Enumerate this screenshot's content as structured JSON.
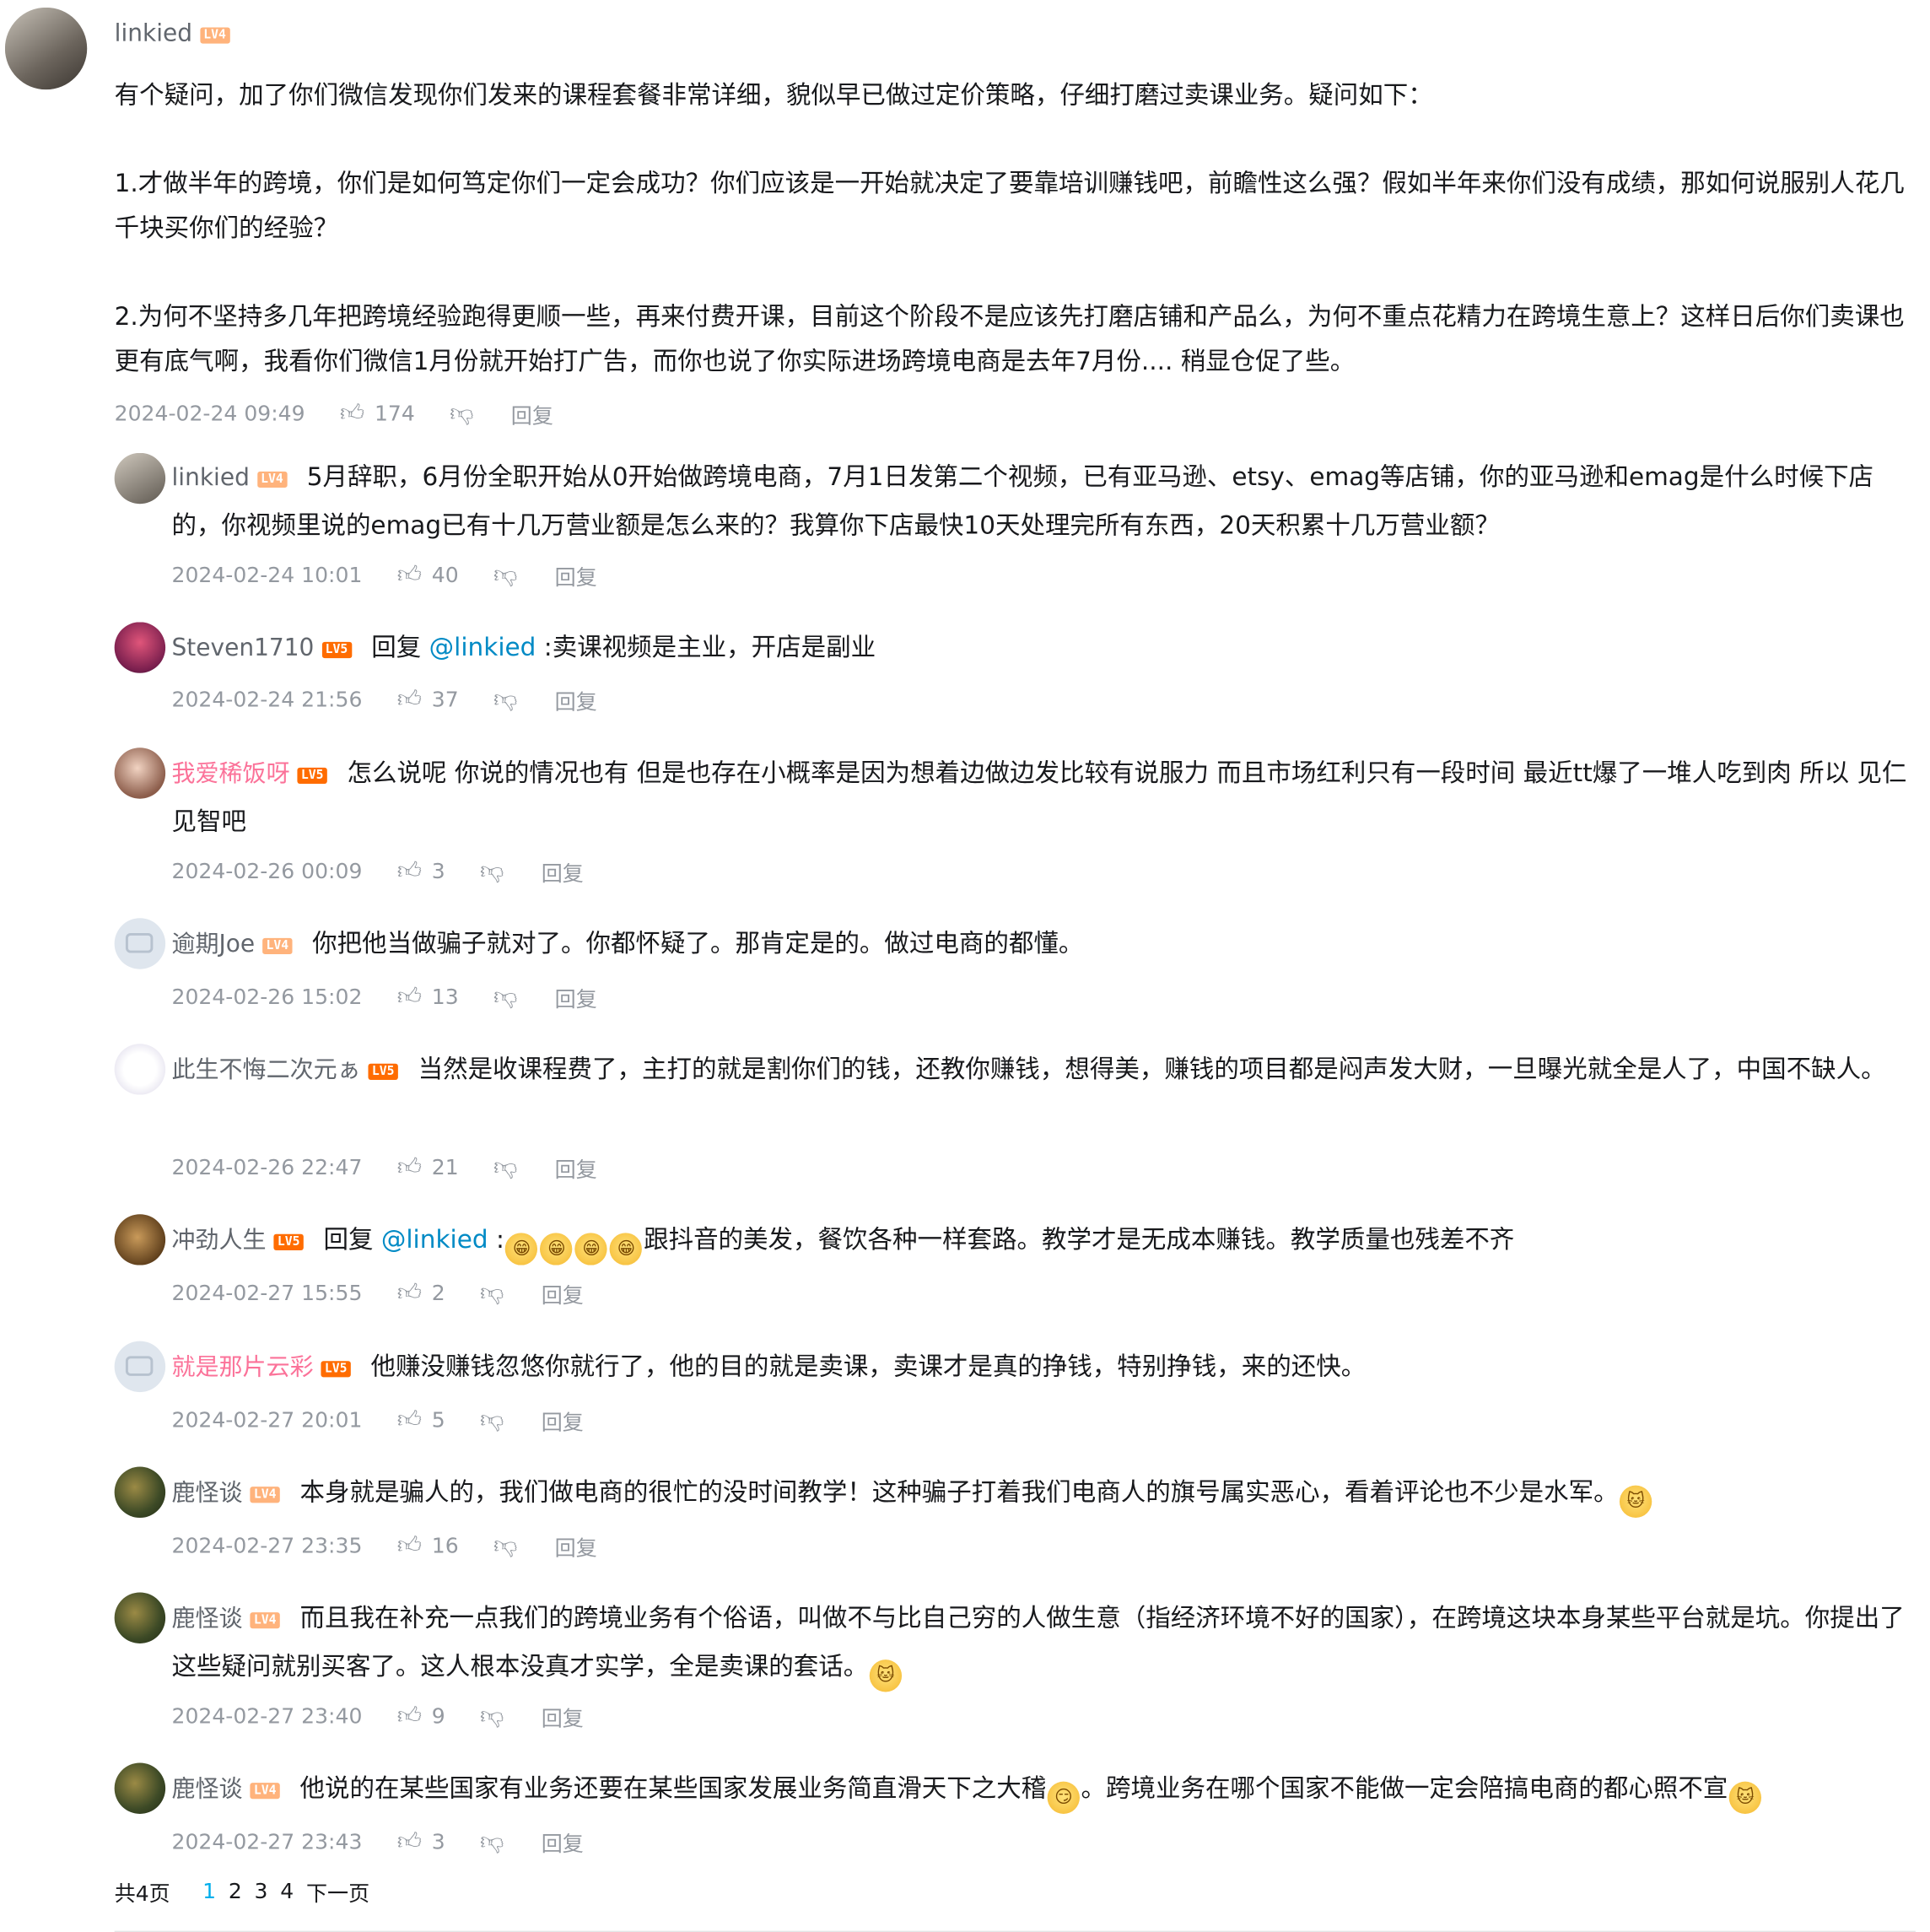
{
  "root": {
    "user": "linkied",
    "level": "LV4",
    "paragraphs": [
      "有个疑问，加了你们微信发现你们发来的课程套餐非常详细，貌似早已做过定价策略，仔细打磨过卖课业务。疑问如下：",
      "1.才做半年的跨境，你们是如何笃定你们一定会成功？你们应该是一开始就决定了要靠培训赚钱吧，前瞻性这么强？假如半年来你们没有成绩，那如何说服别人花几千块买你们的经验？",
      "2.为何不坚持多几年把跨境经验跑得更顺一些，再来付费开课，目前这个阶段不是应该先打磨店铺和产品么，为何不重点花精力在跨境生意上？这样日后你们卖课也更有底气啊，我看你们微信1月份就开始打广告，而你也说了你实际进场跨境电商是去年7月份.... 稍显仓促了些。"
    ],
    "time": "2024-02-24 09:49",
    "likes": "174",
    "reply_label": "回复"
  },
  "replies": [
    {
      "user": "linkied",
      "level": "LV4",
      "text": "5月辞职，6月份全职开始从0开始做跨境电商，7月1日发第二个视频，已有亚马逊、etsy、emag等店铺，你的亚马逊和emag是什么时候下店的，你视频里说的emag已有十几万营业额是怎么来的？我算你下店最快10天处理完所有东西，20天积累十几万营业额？",
      "time": "2024-02-24 10:01",
      "likes": "40"
    },
    {
      "user": "Steven1710",
      "level": "LV5",
      "prefix": "回复 ",
      "at": "@linkied",
      "text": " :卖课视频是主业，开店是副业",
      "time": "2024-02-24 21:56",
      "likes": "37"
    },
    {
      "user": "我爱稀饭呀",
      "level": "LV5",
      "text": "怎么说呢 你说的情况也有 但是也存在小概率是因为想着边做边发比较有说服力 而且市场红利只有一段时间 最近tt爆了一堆人吃到肉 所以 见仁见智吧",
      "time": "2024-02-26 00:09",
      "likes": "3"
    },
    {
      "user": "逾期Joe",
      "level": "LV4",
      "text": "你把他当做骗子就对了。你都怀疑了。那肯定是的。做过电商的都懂。",
      "time": "2024-02-26 15:02",
      "likes": "13"
    },
    {
      "user": "此生不悔二次元ぁ",
      "level": "LV5",
      "text": "当然是收课程费了，主打的就是割你们的钱，还教你赚钱，想得美，赚钱的项目都是闷声发大财，一旦曝光就全是人了，中国不缺人。",
      "time": "2024-02-26 22:47",
      "likes": "21"
    },
    {
      "user": "冲劲人生",
      "level": "LV5",
      "prefix": "回复 ",
      "at": "@linkied",
      "text": " :",
      "text_after": "跟抖音的美发，餐饮各种一样套路。教学才是无成本赚钱。教学质量也残差不齐",
      "time": "2024-02-27 15:55",
      "likes": "2"
    },
    {
      "user": "就是那片云彩",
      "level": "LV5",
      "text": "他赚没赚钱忽悠你就行了，他的目的就是卖课，卖课才是真的挣钱，特别挣钱，来的还快。",
      "time": "2024-02-27 20:01",
      "likes": "5"
    },
    {
      "user": "鹿怪谈",
      "level": "LV4",
      "text": "本身就是骗人的，我们做电商的很忙的没时间教学！这种骗子打着我们电商人的旗号属实恶心，看着评论也不少是水军。",
      "time": "2024-02-27 23:35",
      "likes": "16"
    },
    {
      "user": "鹿怪谈",
      "level": "LV4",
      "text": "而且我在补充一点我们的跨境业务有个俗语，叫做不与比自己穷的人做生意（指经济环境不好的国家），在跨境这块本身某些平台就是坑。你提出了这些疑问就别买客了。这人根本没真才实学，全是卖课的套话。",
      "time": "2024-02-27 23:40",
      "likes": "9"
    },
    {
      "user": "鹿怪谈",
      "level": "LV4",
      "text": "他说的在某些国家有业务还要在某些国家发展业务简直滑天下之大稽",
      "text_after": "。跨境业务在哪个国家不能做一定会陪搞电商的都心照不宣",
      "time": "2024-02-27 23:43",
      "likes": "3"
    }
  ],
  "reply_label": "回复",
  "pager": {
    "total": "共4页",
    "pages": [
      "1",
      "2",
      "3",
      "4"
    ],
    "next": "下一页"
  }
}
